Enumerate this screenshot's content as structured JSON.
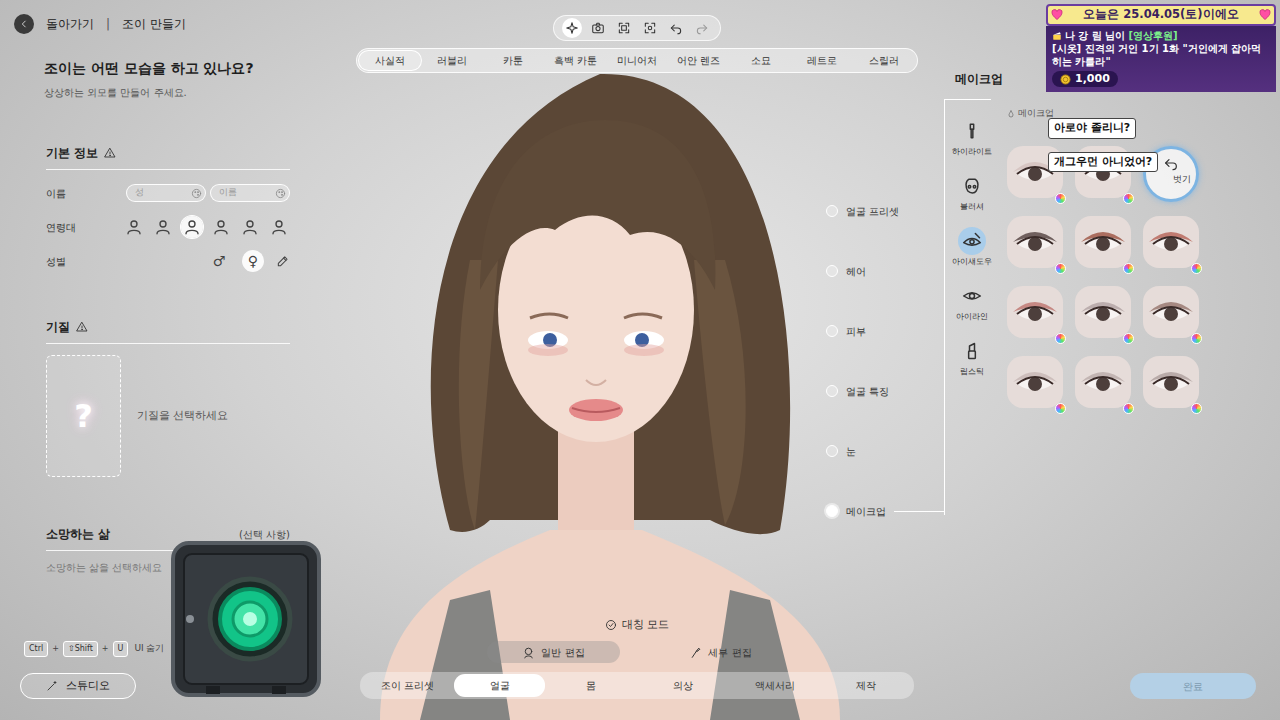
{
  "header": {
    "back_label": "돌아가기",
    "separator": "|",
    "title": "조이 만들기"
  },
  "toolbar": [
    {
      "selected": true
    },
    {
      "selected": false
    },
    {
      "selected": false
    },
    {
      "selected": false
    },
    {
      "selected": false
    },
    {
      "selected": false
    }
  ],
  "style_tabs": [
    {
      "label": "사실적",
      "selected": true
    },
    {
      "label": "러블리",
      "selected": false
    },
    {
      "label": "카툰",
      "selected": false
    },
    {
      "label": "흑백 카툰",
      "selected": false
    },
    {
      "label": "미니어처",
      "selected": false
    },
    {
      "label": "어안 렌즈",
      "selected": false
    },
    {
      "label": "소묘",
      "selected": false
    },
    {
      "label": "레트로",
      "selected": false
    },
    {
      "label": "스릴러",
      "selected": false
    }
  ],
  "intro": {
    "title": "조이는 어떤 모습을 하고 있나요?",
    "subtitle": "상상하는 외모를 만들어 주세요."
  },
  "basic_info": {
    "heading": "기본 정보",
    "name_label": "이름",
    "surname_placeholder": "성",
    "name_placeholder": "이름",
    "age_label": "연령대",
    "ages": [
      {
        "selected": false
      },
      {
        "selected": false
      },
      {
        "selected": true
      },
      {
        "selected": false
      },
      {
        "selected": false
      },
      {
        "selected": false
      }
    ],
    "gender_label": "성별",
    "genders": [
      {
        "symbol": "♂",
        "selected": false
      },
      {
        "symbol": "♀",
        "selected": true
      }
    ]
  },
  "temperament": {
    "heading": "기질",
    "question": "?",
    "prompt": "기질을 선택하세요"
  },
  "aspiration": {
    "heading": "소망하는 삶",
    "optional": "(선택 사항)",
    "prompt": "소망하는 삶을 선택하세요"
  },
  "shortcut": {
    "keys": [
      "Ctrl",
      "⇧Shift",
      "U"
    ],
    "joiner": "+",
    "label": "UI 숨기"
  },
  "studio_button": "스튜디오",
  "nodes": [
    {
      "label": "얼굴 프리셋",
      "selected": false
    },
    {
      "label": "헤어",
      "selected": false
    },
    {
      "label": "피부",
      "selected": false
    },
    {
      "label": "얼굴 특징",
      "selected": false
    },
    {
      "label": "눈",
      "selected": false
    },
    {
      "label": "메이크업",
      "selected": true
    }
  ],
  "symmetry": {
    "label": "대칭 모드",
    "checked": true
  },
  "edit_modes": [
    {
      "label": "일반 편집",
      "selected": true
    },
    {
      "label": "세부 편집",
      "selected": false
    }
  ],
  "bottom_tabs": [
    {
      "label": "조이 프리셋",
      "selected": false
    },
    {
      "label": "얼굴",
      "selected": true
    },
    {
      "label": "몸",
      "selected": false
    },
    {
      "label": "의상",
      "selected": false
    },
    {
      "label": "액세서리",
      "selected": false
    },
    {
      "label": "제작",
      "selected": false
    }
  ],
  "done_button": {
    "label": "완료",
    "disabled": true
  },
  "makeup": {
    "title": "메이크업",
    "subtitle": "메이크업",
    "categories": [
      {
        "label": "하이라이트",
        "selected": false
      },
      {
        "label": "블러셔",
        "selected": false
      },
      {
        "label": "아이섀도우",
        "selected": true
      },
      {
        "label": "아이라인",
        "selected": false
      },
      {
        "label": "립스틱",
        "selected": false
      }
    ],
    "swatches": [
      {
        "kind": "thumb",
        "color": "#d4c2be",
        "selected": false
      },
      {
        "kind": "thumb",
        "color": "#cdb8b4",
        "selected": false
      },
      {
        "kind": "remove",
        "label": "벗기",
        "selected": false
      },
      {
        "kind": "thumb",
        "color": "#5a4a48",
        "selected": false
      },
      {
        "kind": "thumb",
        "color": "#a05a4a",
        "selected": false
      },
      {
        "kind": "thumb",
        "color": "#b86a5e",
        "selected": false
      },
      {
        "kind": "thumb",
        "color": "#c07a74",
        "selected": false
      },
      {
        "kind": "thumb",
        "color": "#b4a6a6",
        "selected": false
      },
      {
        "kind": "thumb",
        "color": "#9a7a72",
        "selected": false
      },
      {
        "kind": "thumb",
        "color": "#c8b8b6",
        "selected": false
      },
      {
        "kind": "thumb",
        "color": "#bcaeac",
        "selected": false
      },
      {
        "kind": "thumb",
        "color": "#b0a2a0",
        "selected": false
      }
    ]
  },
  "stream_overlay": {
    "date": "오늘은 25.04.05(토)이에오",
    "donor": "나 강 림 님이",
    "tag": "[영상후원]",
    "message": "[시옷] 진격의 거인 1기 1화 \"거인에게 잡아먹히는 카를라\"",
    "amount": "1,000"
  },
  "chat": [
    {
      "text": "아로야 졸리니?"
    },
    {
      "text": "개그우먼 아니었어?"
    }
  ]
}
